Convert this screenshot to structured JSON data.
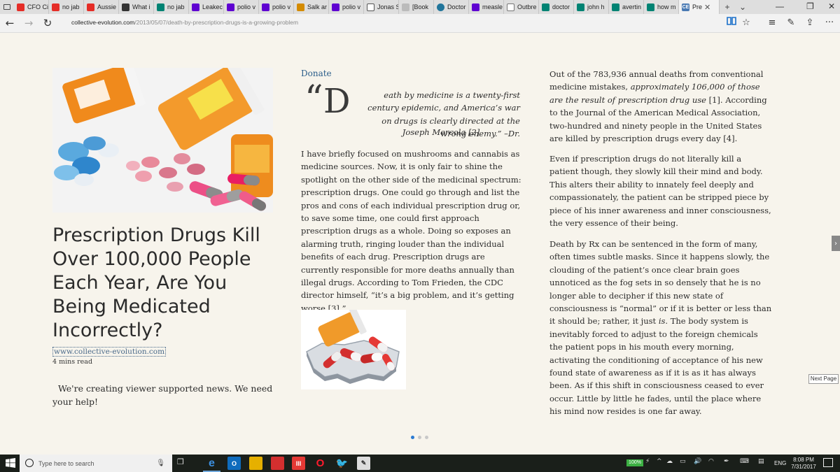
{
  "browser": {
    "tabs": [
      {
        "label": "CFO Ci",
        "icon": "youtube-icon",
        "kind": "youtube"
      },
      {
        "label": "no jab",
        "icon": "youtube-icon",
        "kind": "youtube"
      },
      {
        "label": "Aussie",
        "icon": "youtube-icon",
        "kind": "youtube"
      },
      {
        "label": "What i",
        "icon": "w-icon",
        "kind": "w"
      },
      {
        "label": "no jab",
        "icon": "bing-icon",
        "kind": "bing"
      },
      {
        "label": "Leakec",
        "icon": "yahoo-icon",
        "kind": "yahoo"
      },
      {
        "label": "polio v",
        "icon": "yahoo-icon",
        "kind": "yahoo"
      },
      {
        "label": "polio v",
        "icon": "yahoo-icon",
        "kind": "yahoo"
      },
      {
        "label": "Salk ar",
        "icon": "salk-icon",
        "kind": "salk"
      },
      {
        "label": "polio v",
        "icon": "yahoo-icon",
        "kind": "yahoo"
      },
      {
        "label": "Jonas S",
        "icon": "person-icon",
        "kind": "jonas"
      },
      {
        "label": "[Book",
        "icon": "page-icon",
        "kind": "book"
      },
      {
        "label": "Doctor",
        "icon": "wordpress-icon",
        "kind": "wp"
      },
      {
        "label": "measle",
        "icon": "yahoo-icon",
        "kind": "yahoo"
      },
      {
        "label": "Outbre",
        "icon": "page-icon",
        "kind": "outb"
      },
      {
        "label": "doctor",
        "icon": "bing-icon",
        "kind": "bing"
      },
      {
        "label": "john h",
        "icon": "bing-icon",
        "kind": "bing"
      },
      {
        "label": "avertin",
        "icon": "bing-icon",
        "kind": "bing"
      },
      {
        "label": "how m",
        "icon": "bing-icon",
        "kind": "bing"
      }
    ],
    "active_tab": {
      "label": "Pre",
      "icon_text": "CE"
    },
    "new_tab_glyph": "+",
    "tab_list_glyph": "⌄",
    "url_host": "collective-evolution.com",
    "url_path": "/2013/05/07/death-by-prescription-drugs-is-a-growing-problem"
  },
  "article": {
    "title": "Prescription Drugs Kill Over 100,000 People Each Year, Are You Being Medicated Incorrectly?",
    "source": "www.collective-evolution.com",
    "read_time": "4 mins read",
    "support_text": "We're creating viewer supported news. We need your help!",
    "donate": "Donate",
    "quote_mark": "“",
    "dropcap": "D",
    "quote": "eath by medicine is a twenty-first century epidemic, and America’s war on drugs is clearly directed at the wrong enemy.” –Dr.",
    "quote_attribution": "Joseph Mercola [2]",
    "p1": "I have briefly focused on mushrooms and cannabis as medicine sources. Now, it is only fair to shine the spotlight on the other side of the medicinal spectrum: prescription drugs. One could go through and list the pros and cons of each individual prescription drug or, to save some time, one could first approach prescription drugs as a whole. Doing so exposes an alarming truth, ringing louder than the individual benefits of each drug.  Prescription drugs are currently responsible for more deaths annually than illegal drugs.  According to Tom Frieden, the CDC director himself, “it’s a big problem, and it’s getting worse [3].”",
    "p2_a": "Out of the 783,936 annual deaths from conventional medicine mistakes, ",
    "p2_em": "approximately 106,000 of those are the result of prescription drug use",
    "p2_b": " [1]. According to the Journal of the American Medical Association, two-hundred and ninety people in the United States are killed by prescription drugs every day [4].",
    "p3": "Even if prescription drugs do not literally kill a patient though, they slowly kill their mind and body. This alters their ability to innately feel deeply and compassionately, the patient can be stripped piece by piece of his inner awareness and inner consciousness, the very essence of their being.",
    "p4_a": "Death by Rx can be sentenced in the form of many, often times subtle masks. Since it happens slowly, the clouding of the patient’s once clear brain goes unnoticed as the fog sets in so densely that he is no longer able to decipher if this new state of consciousness is “normal” or if it is better or less than it should be; rather, it just ",
    "p4_em": "is",
    "p4_b": ". The body system is inevitably forced to adjust to the foreign  chemicals the patient pops in his mouth every morning, activating the conditioning of acceptance of his new found state of awareness as if it is as it has always been. As if this shift in consciousness ceased to ever occur. Little by little he fades, until the place where his mind now resides is one far away.",
    "next_page": "Next Page",
    "page_count": 3,
    "current_page": 1
  },
  "taskbar": {
    "search_placeholder": "Type here to search",
    "battery": "100%",
    "language": "ENG",
    "time": "8:08 PM",
    "date": "7/31/2017"
  },
  "colors": {
    "page_bg": "#f7f4ec",
    "link": "#2a5d8a",
    "accent": "#2a7ad2",
    "taskbar": "#1a1f1a"
  }
}
